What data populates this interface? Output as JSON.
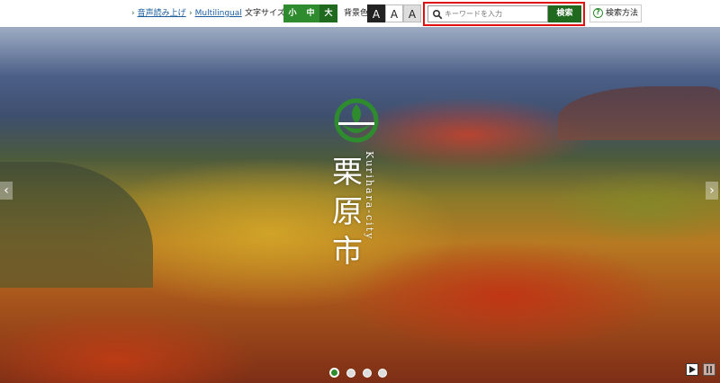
{
  "topbar": {
    "voice_label": "音声読み上げ",
    "multilingual_label": "Multilingual",
    "font_size_label": "文字サイズ",
    "font_sizes": [
      "小",
      "中",
      "大"
    ],
    "bg_color_label": "背景色",
    "bg_options": [
      "A",
      "A",
      "A"
    ]
  },
  "search": {
    "placeholder": "キーワードを入力",
    "button_label": "検索",
    "help_label": "検索方法"
  },
  "hero": {
    "city_name": "栗原市",
    "city_roman": "Kurihara-city",
    "slides_total": 4,
    "slides_active": 1
  },
  "colors": {
    "accent_green": "#2e8b2e",
    "search_highlight": "#e01010"
  },
  "icons": [
    "search-icon",
    "help-icon",
    "prev-arrow-icon",
    "next-arrow-icon",
    "play-icon",
    "pause-icon"
  ]
}
